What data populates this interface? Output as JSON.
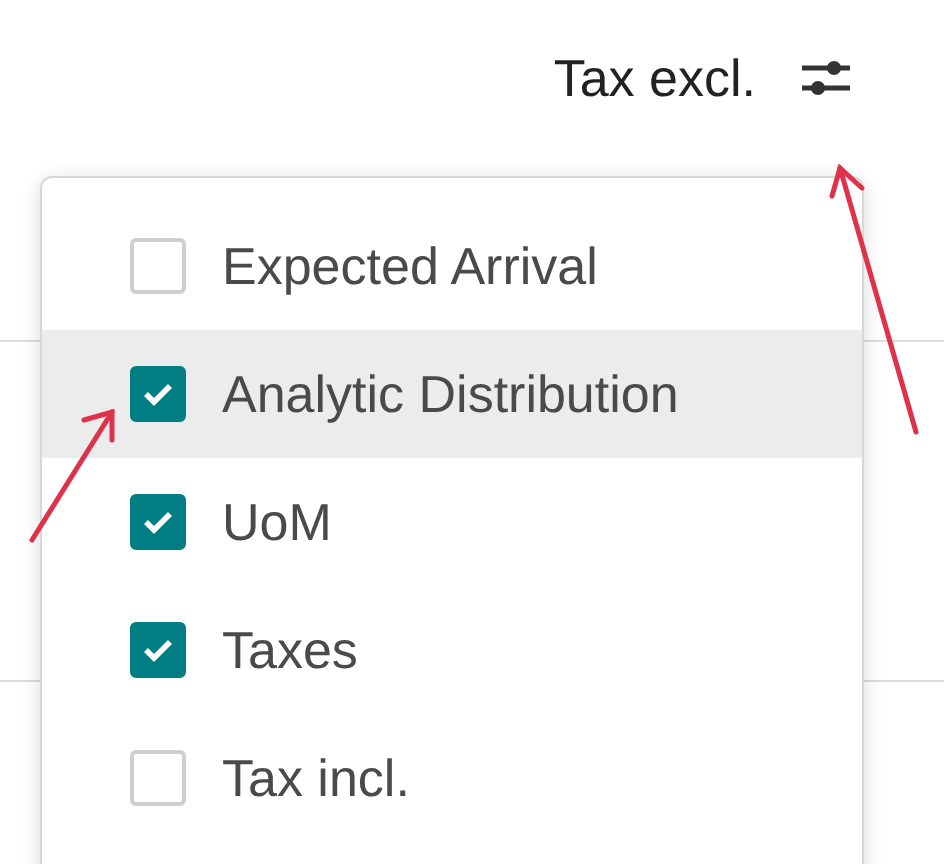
{
  "header": {
    "label": "Tax excl."
  },
  "menu": {
    "options": [
      {
        "label": "Expected Arrival",
        "checked": false,
        "highlighted": false
      },
      {
        "label": "Analytic Distribution",
        "checked": true,
        "highlighted": true
      },
      {
        "label": "UoM",
        "checked": true,
        "highlighted": false
      },
      {
        "label": "Taxes",
        "checked": true,
        "highlighted": false
      },
      {
        "label": "Tax incl.",
        "checked": false,
        "highlighted": false
      }
    ]
  }
}
